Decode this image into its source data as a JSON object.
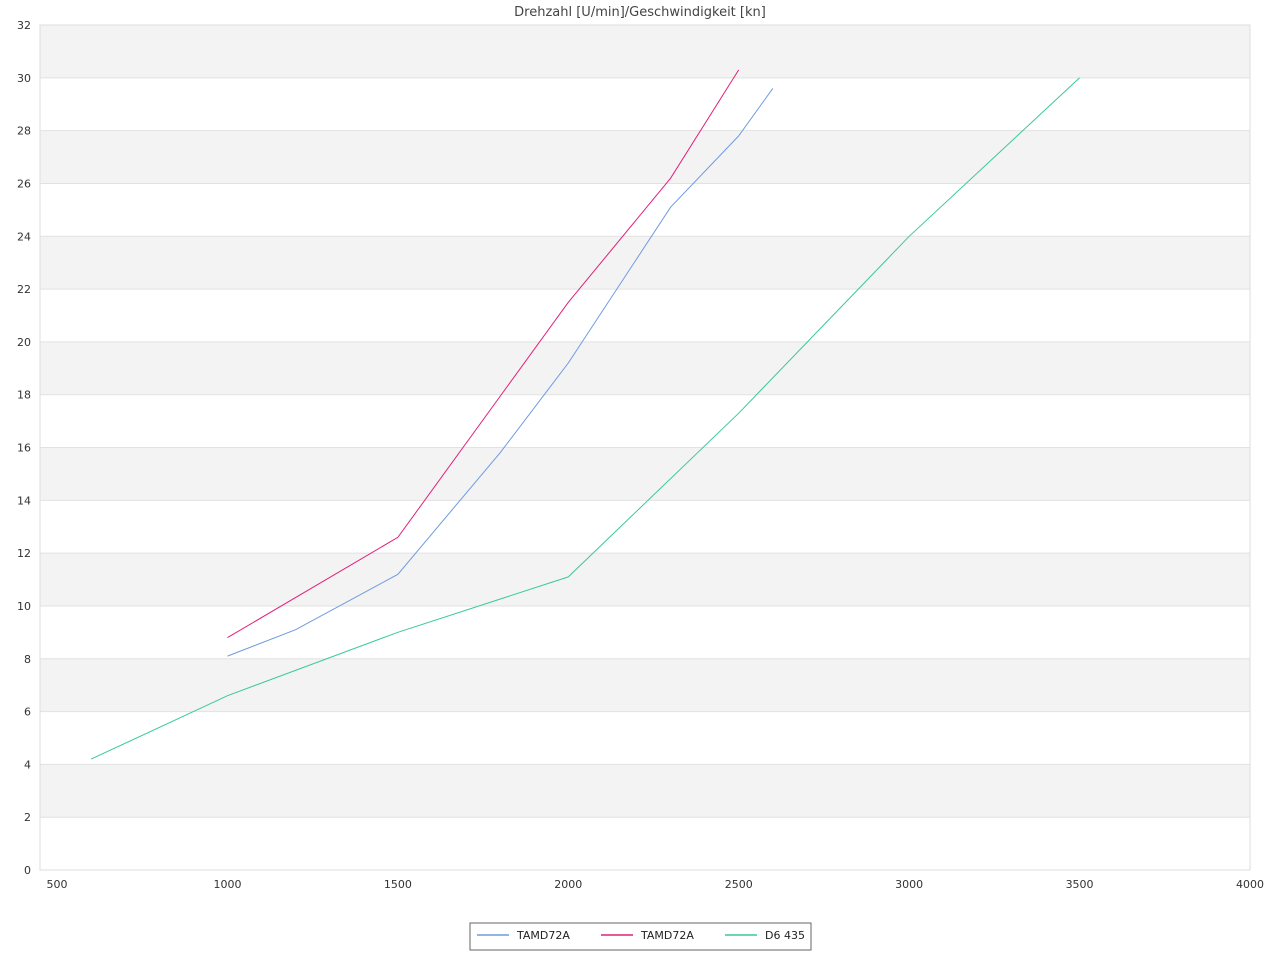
{
  "chart_data": {
    "type": "line",
    "title": "Drehzahl [U/min]/Geschwindigkeit [kn]",
    "xlabel": "",
    "ylabel": "",
    "xlim": [
      450,
      4000
    ],
    "ylim": [
      0,
      32
    ],
    "x_ticks": [
      500,
      1000,
      1500,
      2000,
      2500,
      3000,
      3500,
      4000
    ],
    "y_ticks": [
      0,
      2,
      4,
      6,
      8,
      10,
      12,
      14,
      16,
      18,
      20,
      22,
      24,
      26,
      28,
      30,
      32
    ],
    "grid": true,
    "legend_position": "bottom-center",
    "series": [
      {
        "name": "TAMD72A",
        "color": "#6f9be0",
        "points": [
          [
            1000,
            8.1
          ],
          [
            1200,
            9.1
          ],
          [
            1500,
            11.2
          ],
          [
            1800,
            15.8
          ],
          [
            2000,
            19.2
          ],
          [
            2300,
            25.1
          ],
          [
            2500,
            27.8
          ],
          [
            2600,
            29.6
          ]
        ]
      },
      {
        "name": "TAMD72A",
        "color": "#e0207a",
        "points": [
          [
            1000,
            8.8
          ],
          [
            1500,
            12.6
          ],
          [
            2000,
            21.5
          ],
          [
            2300,
            26.2
          ],
          [
            2500,
            30.3
          ]
        ]
      },
      {
        "name": "D6 435",
        "color": "#3ac99a",
        "points": [
          [
            600,
            4.2
          ],
          [
            1000,
            6.6
          ],
          [
            1500,
            9.0
          ],
          [
            2000,
            11.1
          ],
          [
            2500,
            17.3
          ],
          [
            3000,
            24.0
          ],
          [
            3500,
            30.0
          ]
        ]
      }
    ]
  }
}
